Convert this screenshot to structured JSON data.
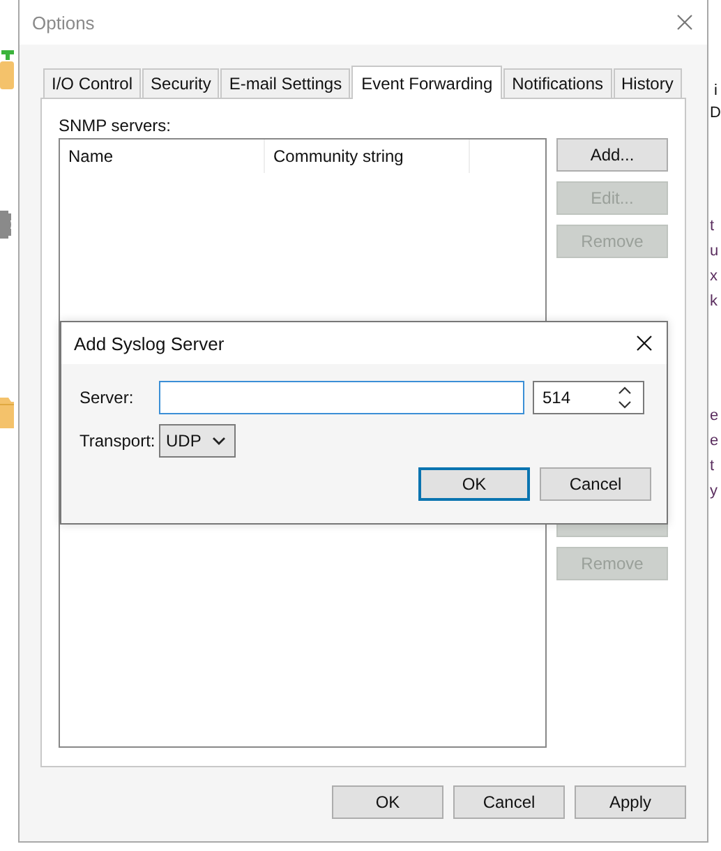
{
  "background": {
    "fragments": [
      {
        "text": "i"
      },
      {
        "text": "D"
      },
      {
        "text": "t"
      },
      {
        "text": "u"
      },
      {
        "text": "x"
      },
      {
        "text": "k"
      },
      {
        "text": "e"
      },
      {
        "text": "e"
      },
      {
        "text": "t"
      },
      {
        "text": "y"
      }
    ]
  },
  "window": {
    "title": "Options"
  },
  "tabs": [
    {
      "label": "I/O Control",
      "selected": false
    },
    {
      "label": "Security",
      "selected": false
    },
    {
      "label": "E-mail Settings",
      "selected": false
    },
    {
      "label": "Event Forwarding",
      "selected": true
    },
    {
      "label": "Notifications",
      "selected": false
    },
    {
      "label": "History",
      "selected": false
    }
  ],
  "snmp": {
    "label": "SNMP servers:",
    "columns": [
      "Name",
      "Community string"
    ],
    "buttons": [
      {
        "label": "Add...",
        "disabled": false
      },
      {
        "label": "Edit...",
        "disabled": true
      },
      {
        "label": "Remove",
        "disabled": true
      }
    ]
  },
  "syslog": {
    "buttons": [
      {
        "disabled": true
      },
      {
        "label": "Remove",
        "disabled": true
      }
    ]
  },
  "dialog": {
    "title": "Add Syslog Server",
    "server_label": "Server:",
    "server_focused": true,
    "port": "514",
    "transport_label": "Transport:",
    "transport": "UDP",
    "buttons": [
      {
        "label": "OK",
        "default": true
      },
      {
        "label": "Cancel",
        "default": false
      }
    ]
  },
  "footer_buttons": [
    "OK",
    "Cancel",
    "Apply"
  ]
}
